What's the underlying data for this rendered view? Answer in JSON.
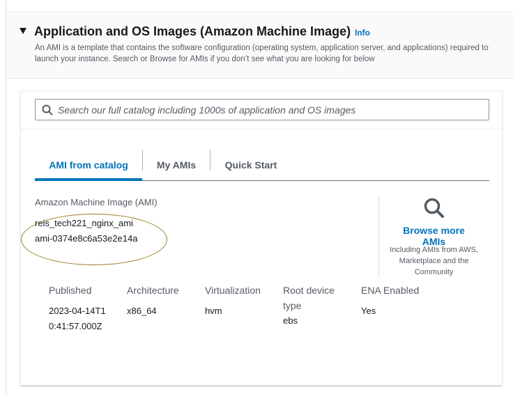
{
  "section": {
    "title": "Application and OS Images (Amazon Machine Image)",
    "info_label": "Info",
    "description": "An AMI is a template that contains the software configuration (operating system, application server, and applications) required to launch your instance. Search or Browse for AMIs if you don’t see what you are looking for below"
  },
  "search": {
    "placeholder": "Search our full catalog including 1000s of application and OS images",
    "value": ""
  },
  "tabs": [
    {
      "label": "AMI from catalog",
      "active": true
    },
    {
      "label": "My AMIs",
      "active": false
    },
    {
      "label": "Quick Start",
      "active": false
    }
  ],
  "ami": {
    "label": "Amazon Machine Image (AMI)",
    "name": "reis_tech221_nginx_ami",
    "id": "ami-0374e8c6a53e2e14a"
  },
  "browse": {
    "link_label": "Browse more AMIs",
    "description": "Including AMIs from AWS, Marketplace and the Community"
  },
  "details": [
    {
      "header": "Published",
      "value": "2023-04-14T10:41:57.000Z"
    },
    {
      "header": "Architecture",
      "value": "x86_64"
    },
    {
      "header": "Virtualization",
      "value": "hvm"
    },
    {
      "header": "Root device type",
      "value": "ebs"
    },
    {
      "header": "ENA Enabled",
      "value": "Yes"
    }
  ],
  "colors": {
    "link": "#0073bb",
    "text": "#16191f",
    "muted": "#545b64",
    "highlight_outline": "#9e7b2a"
  }
}
